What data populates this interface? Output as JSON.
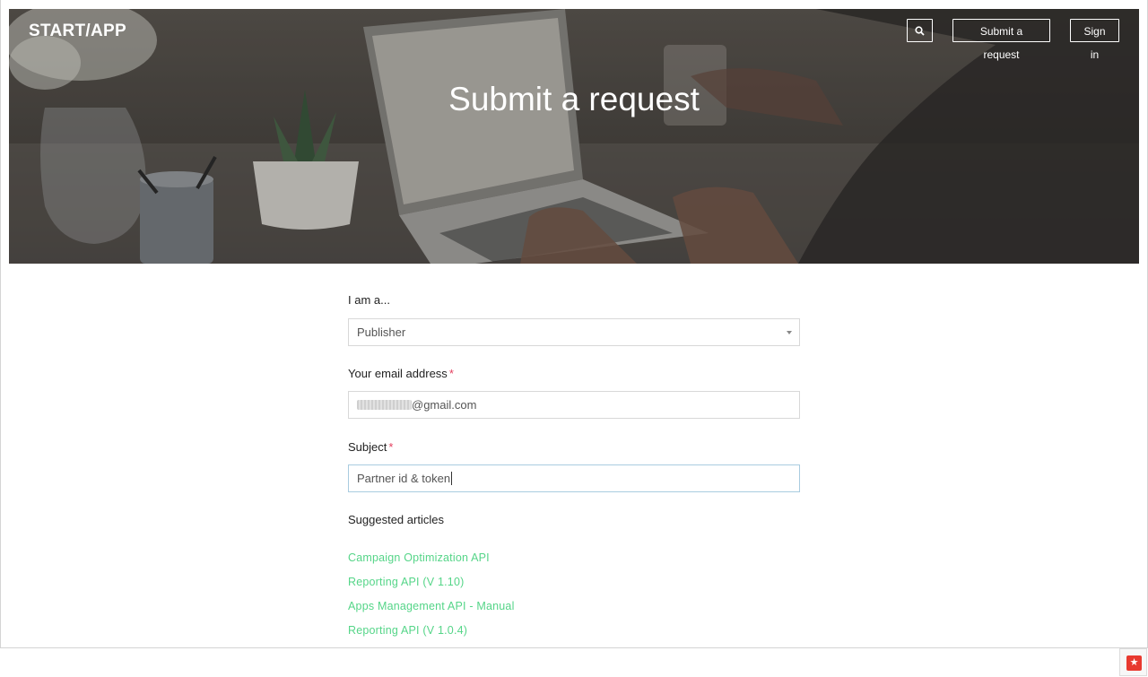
{
  "header": {
    "logo_text": "START/APP",
    "submit_label": "Submit a request",
    "signin_label": "Sign in",
    "search_icon": "search-icon"
  },
  "hero": {
    "title": "Submit a request"
  },
  "form": {
    "role": {
      "label": "I am a...",
      "value": "Publisher"
    },
    "email": {
      "label": "Your email address",
      "required_mark": "*",
      "value": "@gmail.com"
    },
    "subject": {
      "label": "Subject",
      "required_mark": "*",
      "value": "Partner id & token"
    },
    "suggested": {
      "heading": "Suggested articles",
      "articles": [
        "Campaign Optimization API",
        "Reporting API (V 1.10)",
        "Apps Management API - Manual",
        "Reporting API (V 1.0.4)"
      ]
    }
  },
  "colors": {
    "link": "#55d588",
    "required": "#e4405f"
  }
}
